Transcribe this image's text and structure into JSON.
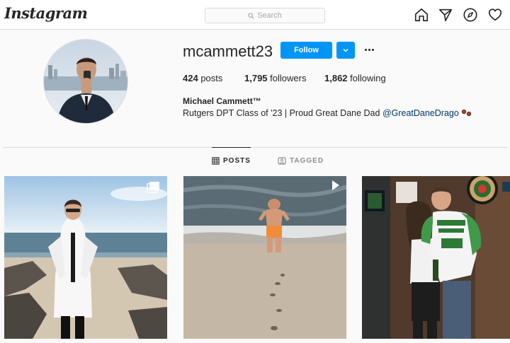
{
  "nav": {
    "logo": "Instagram",
    "search_placeholder": "Search",
    "icons": [
      "home-icon",
      "direct-icon",
      "explore-icon",
      "activity-heart-icon"
    ]
  },
  "profile": {
    "username": "mcammett23",
    "follow_label": "Follow",
    "posts_count": "424",
    "posts_label": "posts",
    "followers_count": "1,795",
    "followers_label": "followers",
    "following_count": "1,862",
    "following_label": "following",
    "full_name": "Michael Cammett™",
    "bio_text": "Rutgers DPT Class of '23 | Proud Great Dane Dad",
    "bio_mention": "@GreatDaneDrago",
    "bio_emoji": "paw-prints-emoji"
  },
  "tabs": [
    {
      "label": "POSTS",
      "active": true,
      "icon": "grid-icon"
    },
    {
      "label": "TAGGED",
      "active": false,
      "icon": "tagged-icon"
    }
  ],
  "posts": [
    {
      "description": "man in white coat on beach",
      "overlay_icon": "multiple-photos-icon"
    },
    {
      "description": "man walking to ocean",
      "overlay_icon": "video-icon"
    },
    {
      "description": "couple at bar",
      "overlay_icon": null
    }
  ],
  "colors": {
    "accent_blue": "#0095f6",
    "mention": "#00376b",
    "border": "#dbdbdb"
  }
}
